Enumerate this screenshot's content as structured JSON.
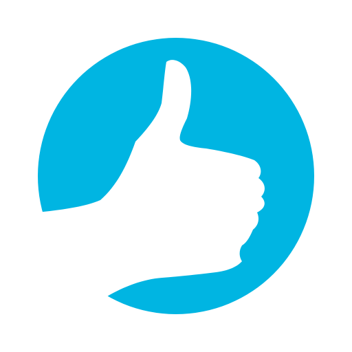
{
  "app_icon": {
    "icon": "thumbs-up-icon",
    "colors": {
      "background": "#ffffff",
      "circle": "#00b5e2",
      "glyph": "#ffffff"
    }
  }
}
